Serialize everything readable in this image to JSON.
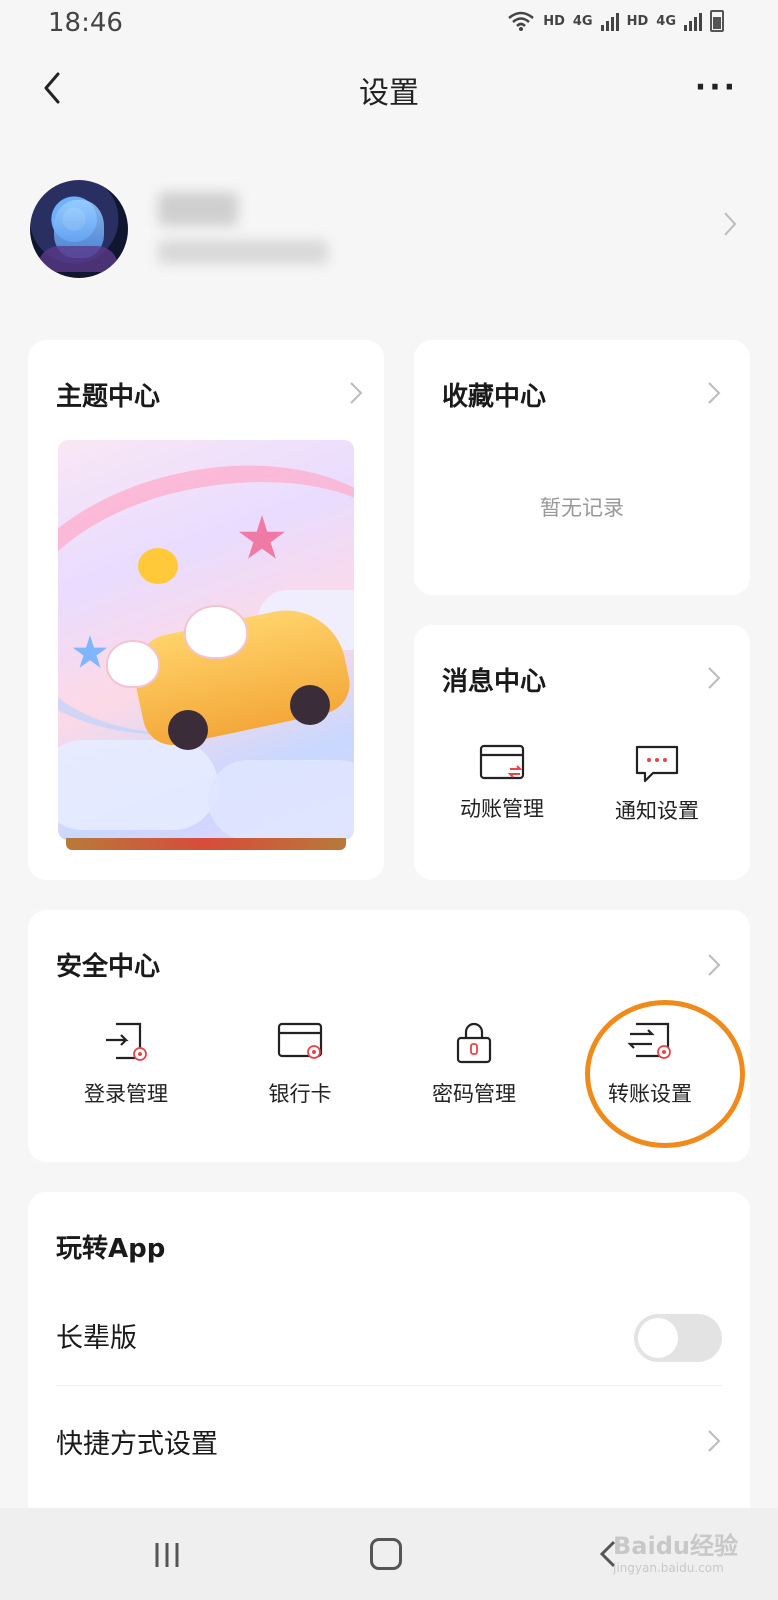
{
  "status_bar": {
    "time": "18:46",
    "network_1": "HD",
    "gen_1": "4G",
    "network_2": "HD",
    "gen_2": "4G"
  },
  "header": {
    "title": "设置",
    "more": "···"
  },
  "theme_center": {
    "title": "主题中心"
  },
  "favorites_center": {
    "title": "收藏中心",
    "empty_text": "暂无记录"
  },
  "message_center": {
    "title": "消息中心",
    "items": [
      {
        "label": "动账管理",
        "icon": "transaction-card-icon"
      },
      {
        "label": "通知设置",
        "icon": "message-bubble-icon"
      }
    ]
  },
  "security_center": {
    "title": "安全中心",
    "items": [
      {
        "label": "登录管理",
        "icon": "login-icon"
      },
      {
        "label": "银行卡",
        "icon": "bank-card-icon"
      },
      {
        "label": "密码管理",
        "icon": "lock-icon"
      },
      {
        "label": "转账设置",
        "icon": "transfer-icon"
      }
    ]
  },
  "play_app": {
    "title": "玩转App",
    "rows": [
      {
        "label": "长辈版",
        "toggle_on": false
      },
      {
        "label": "快捷方式设置"
      }
    ]
  },
  "watermark": {
    "text": "Baidu经验",
    "sub": "jingyan.baidu.com"
  },
  "colors": {
    "accent_red": "#e8454a",
    "highlight_orange": "#f08a1a",
    "background": "#f6f6f6"
  }
}
